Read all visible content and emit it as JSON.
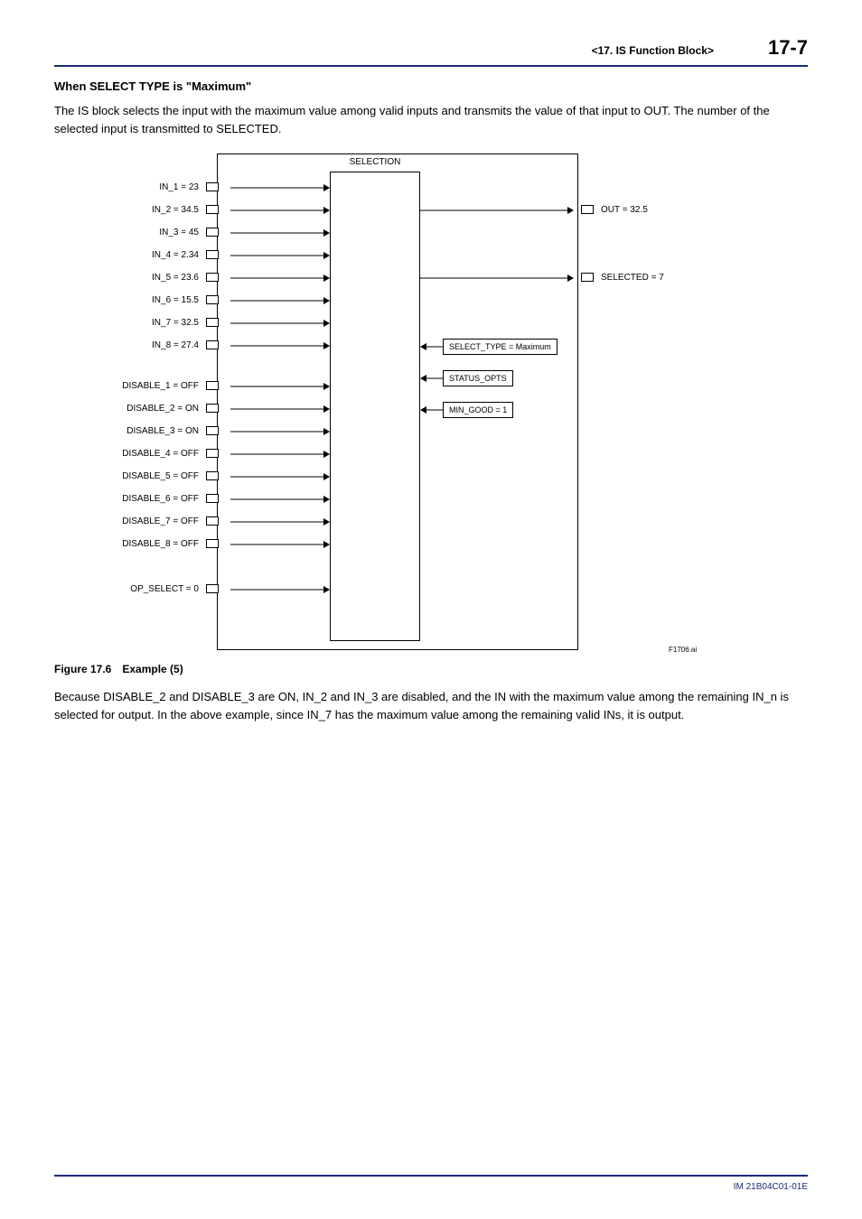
{
  "header": {
    "chapter": "<17.  IS Function Block>",
    "page": "17-7"
  },
  "subheading": "When SELECT TYPE is \"Maximum\"",
  "intro": "The IS block selects the input with the maximum value among valid inputs and transmits the value of that input to OUT. The number of the selected input is transmitted to SELECTED.",
  "diagram": {
    "selection_label": "SELECTION",
    "inputs": [
      "IN_1 = 23",
      "IN_2 = 34.5",
      "IN_3 = 45",
      "IN_4 = 2.34",
      "IN_5 = 23.6",
      "IN_6 = 15.5",
      "IN_7 = 32.5",
      "IN_8 = 27.4"
    ],
    "disables": [
      "DISABLE_1 = OFF",
      "DISABLE_2 = ON",
      "DISABLE_3 = ON",
      "DISABLE_4 = OFF",
      "DISABLE_5 = OFF",
      "DISABLE_6 = OFF",
      "DISABLE_7 = OFF",
      "DISABLE_8 = OFF"
    ],
    "op_select": "OP_SELECT = 0",
    "params": {
      "select_type": "SELECT_TYPE = Maximum",
      "status_opts": "STATUS_OPTS",
      "min_good": "MIN_GOOD = 1"
    },
    "outputs": {
      "out": "OUT = 32.5",
      "selected": "SELECTED = 7"
    },
    "ref": "F1706.ai"
  },
  "figure_caption": "Figure 17.6 Example (5)",
  "explain": "Because DISABLE_2 and DISABLE_3 are ON, IN_2 and IN_3 are disabled, and the IN with the maximum value among the remaining IN_n is selected for output. In the above example, since IN_7 has the maximum value among the remaining valid INs, it is output.",
  "footer_doc": "IM 21B04C01-01E"
}
